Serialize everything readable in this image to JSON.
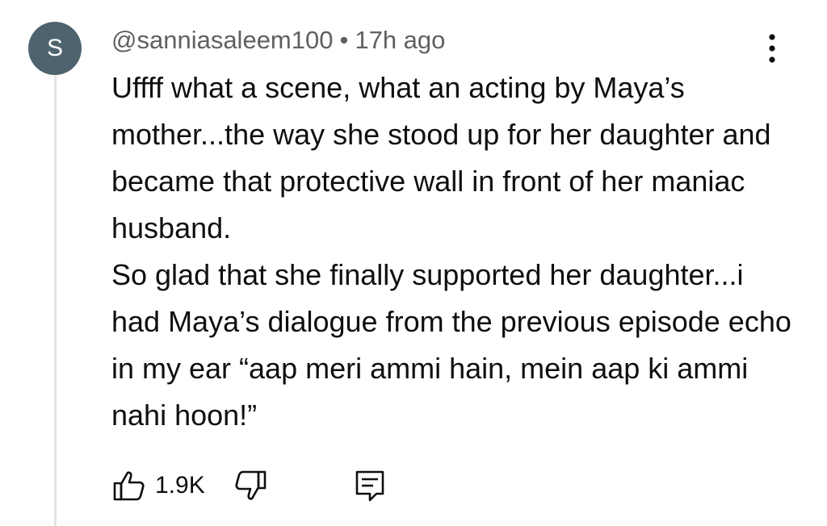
{
  "comment": {
    "avatar_letter": "S",
    "avatar_color": "#4f636e",
    "author": "@sanniasaleem100",
    "separator": "•",
    "timestamp": "17h ago",
    "paragraphs": [
      "Uffff what a scene, what an acting by Maya’s mother...the way she stood up for her daughter and became that protective wall in front of her maniac husband.",
      "So glad that she finally supported her daughter...i had Maya’s dialogue from the previous episode echo in my ear “aap meri ammi hain, mein aap ki ammi nahi hoon!”"
    ],
    "like_count": "1.9K"
  },
  "icons": {
    "more": "more-vertical-icon",
    "like": "thumbs-up-icon",
    "dislike": "thumbs-down-icon",
    "reply": "reply-comment-icon"
  }
}
